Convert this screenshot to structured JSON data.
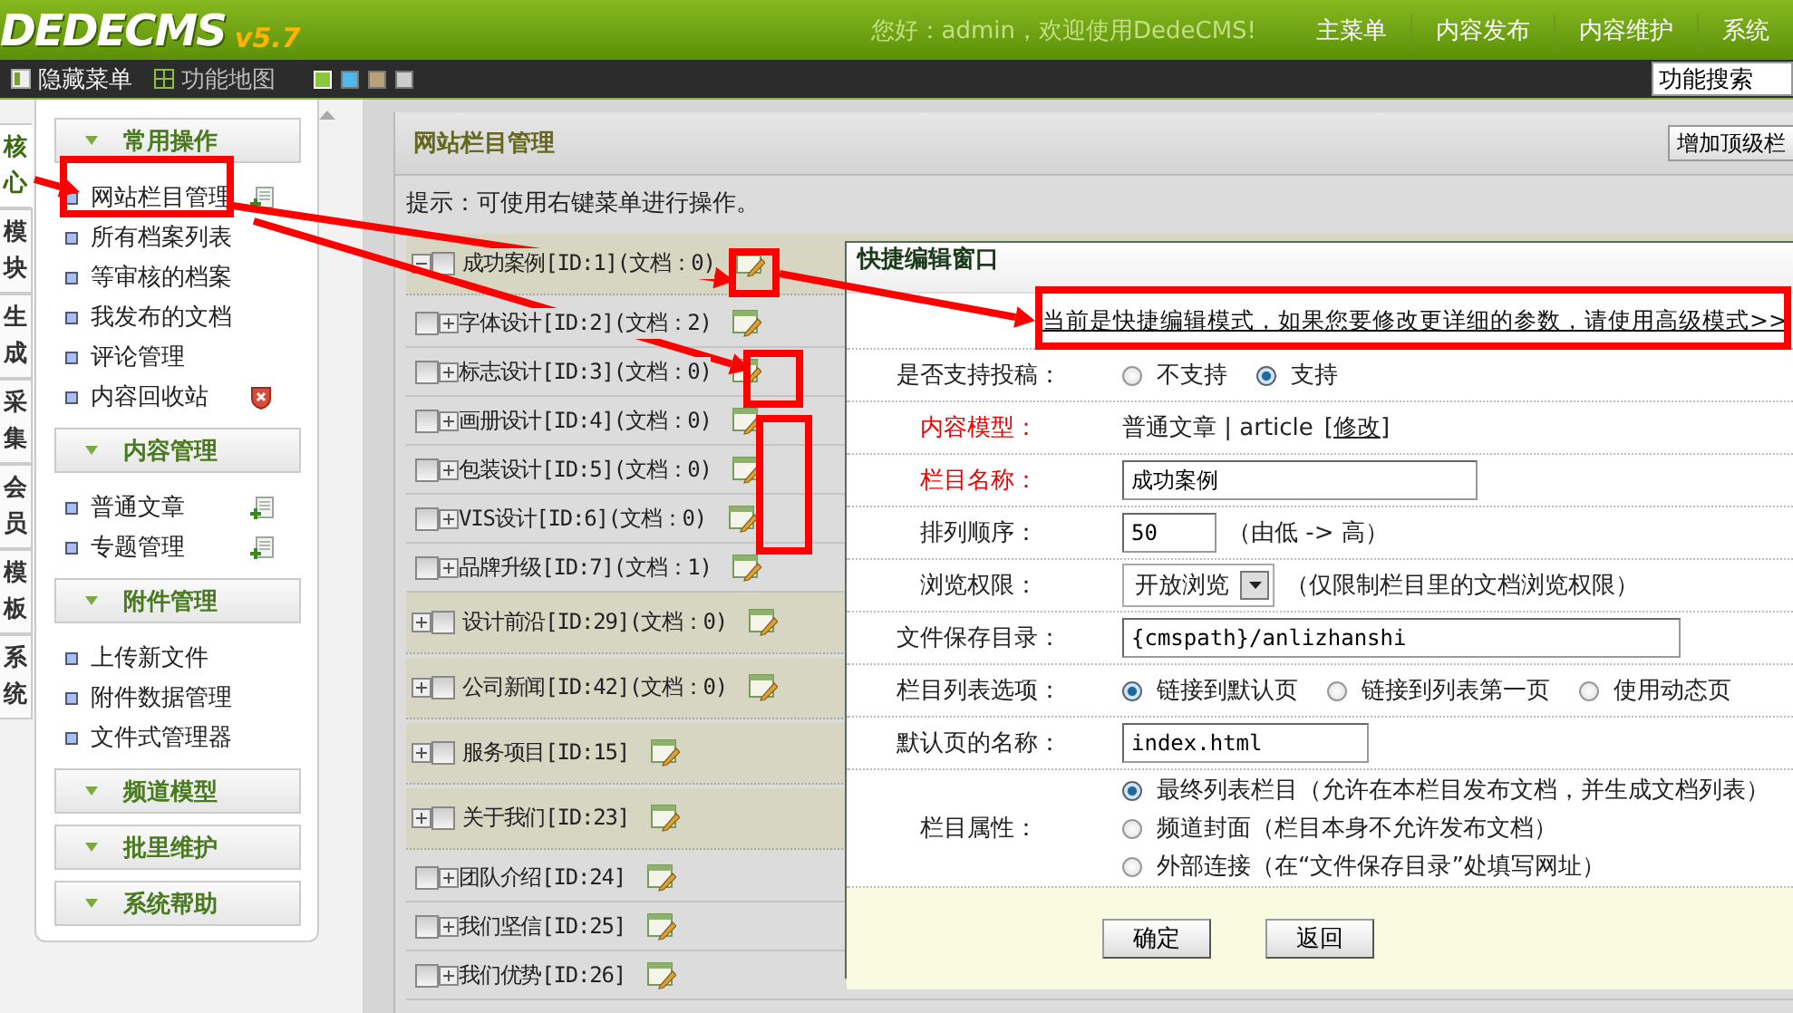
{
  "header": {
    "logo": "DEDECMS",
    "version": "v5.7",
    "greeting": "您好：admin，欢迎使用DedeCMS!",
    "nav": [
      "主菜单",
      "内容发布",
      "内容维护",
      "系统"
    ]
  },
  "toolbar": {
    "items": [
      {
        "label": "隐藏菜单"
      },
      {
        "label": "功能地图"
      }
    ],
    "themes": [
      {
        "color": "#8cc63f",
        "selected": true
      },
      {
        "color": "#4fb8e8",
        "selected": false
      },
      {
        "color": "#b8a07a",
        "selected": false
      },
      {
        "color": "#cccccc",
        "selected": false
      }
    ],
    "search": {
      "value": "功能搜索"
    }
  },
  "side_tabs": [
    {
      "label": "核心",
      "selected": true
    },
    {
      "label": "模块",
      "selected": false
    },
    {
      "label": "生成",
      "selected": false
    },
    {
      "label": "采集",
      "selected": false
    },
    {
      "label": "会员",
      "selected": false
    },
    {
      "label": "模板",
      "selected": false
    },
    {
      "label": "系统",
      "selected": false
    }
  ],
  "menu": {
    "groups": [
      {
        "title": "常用操作",
        "items": [
          {
            "label": "网站栏目管理",
            "kind": "add"
          },
          {
            "label": "所有档案列表"
          },
          {
            "label": "等审核的档案"
          },
          {
            "label": "我发布的文档"
          },
          {
            "label": "评论管理"
          },
          {
            "label": "内容回收站",
            "kind": "delete"
          }
        ]
      },
      {
        "title": "内容管理",
        "items": [
          {
            "label": "普通文章",
            "kind": "add"
          },
          {
            "label": "专题管理",
            "kind": "add"
          }
        ]
      },
      {
        "title": "附件管理",
        "items": [
          {
            "label": "上传新文件"
          },
          {
            "label": "附件数据管理"
          },
          {
            "label": "文件式管理器"
          }
        ]
      },
      {
        "title": "频道模型"
      },
      {
        "title": "批里维护"
      },
      {
        "title": "系统帮助"
      }
    ]
  },
  "main": {
    "title": "网站栏目管理",
    "add_button": "增加顶级栏",
    "hint": "提示：可使用右键菜单进行操作。",
    "tree": [
      {
        "label": "成功案例[ID:1](文档：0)",
        "checked": false,
        "expanded": true,
        "children": [
          {
            "label": "字体设计[ID:2](文档：2)",
            "checked": false,
            "expanded": false
          },
          {
            "label": "标志设计[ID:3](文档：0)",
            "checked": false,
            "expanded": false
          },
          {
            "label": "画册设计[ID:4](文档：0)",
            "checked": false,
            "expanded": false
          },
          {
            "label": "包装设计[ID:5](文档：0)",
            "checked": false,
            "expanded": false
          },
          {
            "label": "VIS设计[ID:6](文档：0)",
            "checked": false,
            "expanded": false
          },
          {
            "label": "品牌升级[ID:7](文档：1)",
            "checked": false,
            "expanded": false
          }
        ]
      },
      {
        "label": "设计前沿[ID:29](文档：0)",
        "checked": false,
        "expanded": false
      },
      {
        "label": "公司新闻[ID:42](文档：0)",
        "checked": false,
        "expanded": false
      },
      {
        "label": "服务项目[ID:15]",
        "checked": false,
        "expanded": false
      },
      {
        "label": "关于我们[ID:23]",
        "checked": false,
        "expanded": false,
        "children": [
          {
            "label": "团队介绍[ID:24]",
            "checked": false,
            "expanded": false
          },
          {
            "label": "我们坚信[ID:25]",
            "checked": false,
            "expanded": false
          },
          {
            "label": "我们优势[ID:26]",
            "checked": false,
            "expanded": false
          }
        ]
      }
    ]
  },
  "dialog": {
    "title": "快捷编辑窗口",
    "notice": "当前是快捷编辑模式，如果您要修改更详细的参数，请使用高级模式>>",
    "fields": [
      {
        "kind": "radio",
        "label": "是否支持投稿：",
        "required": false,
        "options": [
          {
            "label": "不支持",
            "selected": false
          },
          {
            "label": "支持",
            "selected": true
          }
        ]
      },
      {
        "kind": "text",
        "label": "内容模型：",
        "required": true,
        "value": "普通文章 | article",
        "link": "[修改]"
      },
      {
        "kind": "input",
        "label": "栏目名称：",
        "required": true,
        "value": "成功案例"
      },
      {
        "kind": "input",
        "label": "排列顺序：",
        "required": false,
        "value": "50",
        "note": "（由低 -> 高）"
      },
      {
        "kind": "select",
        "label": "浏览权限：",
        "required": false,
        "value": "开放浏览",
        "note": "（仅限制栏目里的文档浏览权限）"
      },
      {
        "kind": "input",
        "label": "文件保存目录：",
        "required": false,
        "value": "{cmspath}/anlizhanshi"
      },
      {
        "kind": "radio",
        "label": "栏目列表选项：",
        "required": false,
        "options": [
          {
            "label": "链接到默认页",
            "selected": true
          },
          {
            "label": "链接到列表第一页",
            "selected": false
          },
          {
            "label": "使用动态页",
            "selected": false
          }
        ]
      },
      {
        "kind": "input",
        "label": "默认页的名称：",
        "required": false,
        "value": "index.html"
      },
      {
        "kind": "radio-stack",
        "label": "栏目属性：",
        "required": false,
        "options": [
          {
            "label": "最终列表栏目（允许在本栏目发布文档，并生成文档列表）",
            "selected": true
          },
          {
            "label": "频道封面（栏目本身不允许发布文档）",
            "selected": false
          },
          {
            "label": "外部连接（在“文件保存目录”处填写网址）",
            "selected": false
          }
        ]
      }
    ],
    "buttons": [
      "确定",
      "返回"
    ]
  },
  "annotations": [
    {
      "kind": "arrow"
    },
    {
      "kind": "box"
    },
    {
      "kind": "arrow"
    },
    {
      "kind": "arrow"
    },
    {
      "kind": "box"
    },
    {
      "kind": "box"
    },
    {
      "kind": "box"
    },
    {
      "kind": "arrow"
    },
    {
      "kind": "box"
    }
  ]
}
